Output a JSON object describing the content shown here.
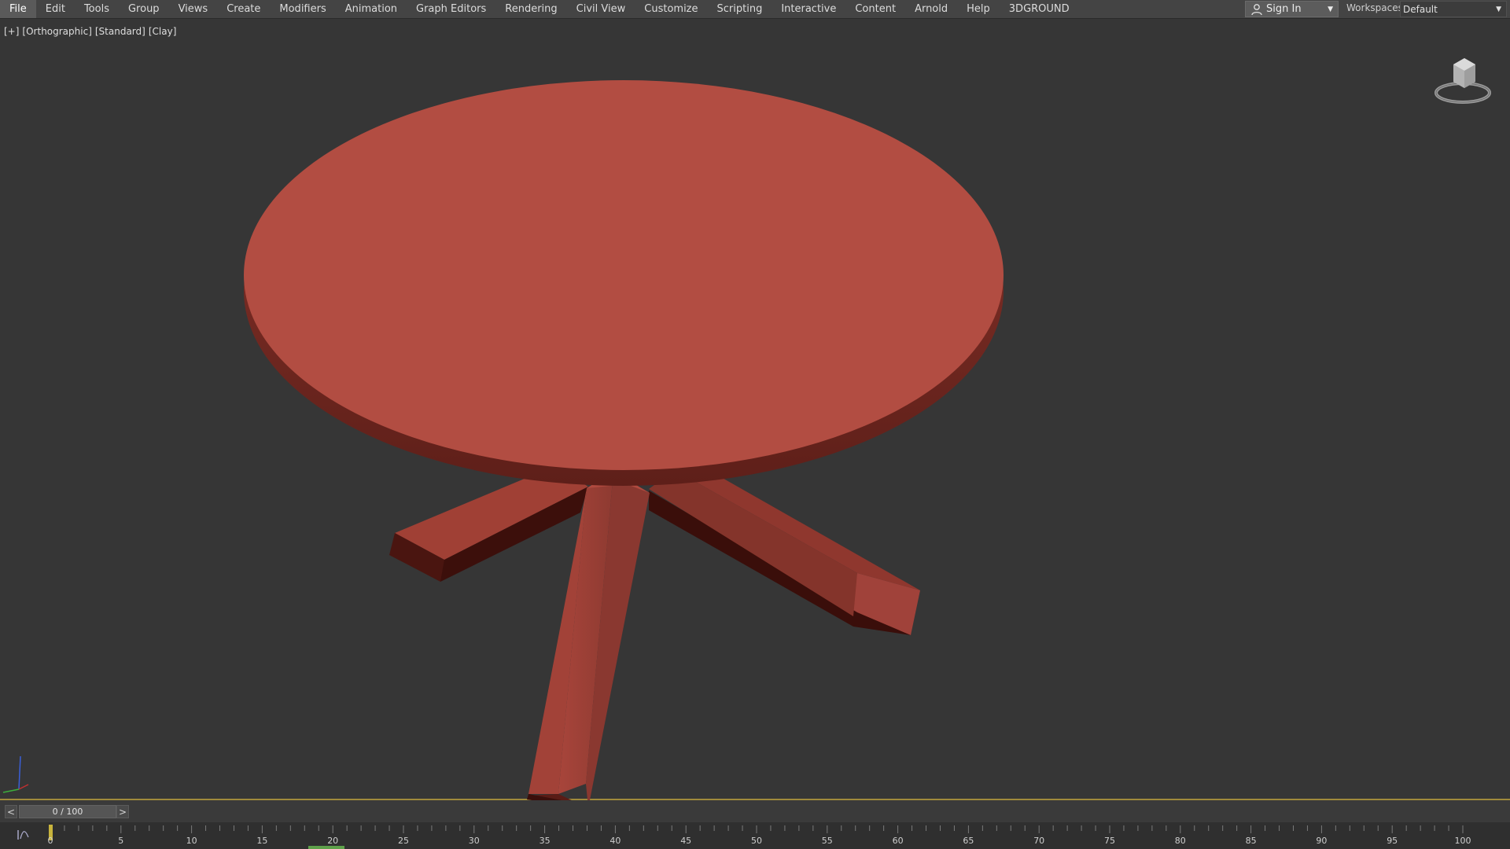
{
  "menu": {
    "items": [
      "File",
      "Edit",
      "Tools",
      "Group",
      "Views",
      "Create",
      "Modifiers",
      "Animation",
      "Graph Editors",
      "Rendering",
      "Civil View",
      "Customize",
      "Scripting",
      "Interactive",
      "Content",
      "Arnold",
      "Help",
      "3DGROUND"
    ],
    "active": "File"
  },
  "signin": {
    "label": "Sign In",
    "icon": "user-icon"
  },
  "workspace": {
    "label": "Workspaces:",
    "value": "Default"
  },
  "viewport": {
    "labels": [
      "[+]",
      "[Orthographic]",
      "[Standard]",
      "[Clay]"
    ],
    "object_color": "#b24d42"
  },
  "timeslider": {
    "prev": "<",
    "next": ">",
    "value": "0 / 100"
  },
  "trackbar": {
    "tick_labels": [
      "0",
      "5",
      "10",
      "15",
      "20",
      "25",
      "30",
      "35",
      "40",
      "45",
      "50",
      "55",
      "60",
      "65",
      "70",
      "75",
      "80",
      "85",
      "90",
      "95",
      "100"
    ],
    "current_frame": 0
  },
  "colors": {
    "accent_gold": "#a08a3c",
    "key_green": "#5ea04a",
    "frame_marker": "#c8b43c"
  }
}
